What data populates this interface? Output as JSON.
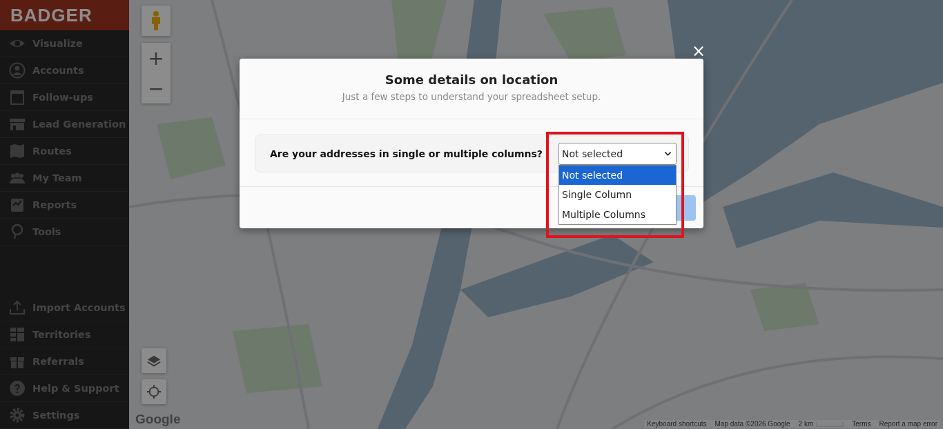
{
  "sidebar": {
    "logo": "BADGER",
    "items": [
      {
        "label": "Visualize"
      },
      {
        "label": "Accounts"
      },
      {
        "label": "Follow-ups"
      },
      {
        "label": "Lead Generation"
      },
      {
        "label": "Routes"
      },
      {
        "label": "My Team"
      },
      {
        "label": "Reports"
      },
      {
        "label": "Tools"
      }
    ],
    "bottom_items": [
      {
        "label": "Import Accounts"
      },
      {
        "label": "Territories"
      },
      {
        "label": "Referrals"
      },
      {
        "label": "Help & Support"
      },
      {
        "label": "Settings"
      }
    ]
  },
  "map": {
    "kind": "picture",
    "zoom_in": "+",
    "zoom_out": "−",
    "logo": "Google",
    "attribution": [
      "Keyboard shortcuts",
      "Map data ©2026 Google",
      "2 km",
      "Terms",
      "Report a map error"
    ]
  },
  "modal": {
    "title": "Some details on location",
    "subtitle": "Just a few steps to understand your spreadsheet setup.",
    "close": "×",
    "question": "Are your addresses in single or multiple columns?",
    "select": {
      "value": "Not selected",
      "highlighted": true,
      "open": true,
      "options": [
        {
          "label": "Not selected",
          "selected": true
        },
        {
          "label": "Single Column",
          "selected": false
        },
        {
          "label": "Multiple Columns",
          "selected": false
        }
      ]
    }
  }
}
